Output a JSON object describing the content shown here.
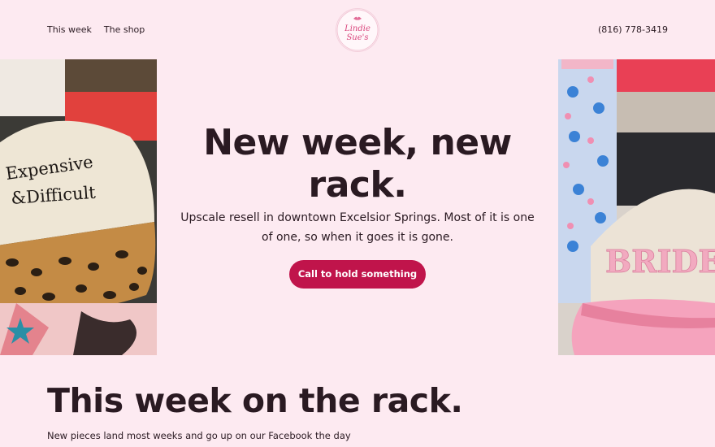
{
  "nav": {
    "items": [
      {
        "label": "This week"
      },
      {
        "label": "The shop"
      }
    ],
    "phone": "(816) 778-3419"
  },
  "logo": {
    "line1": "Lindie",
    "line2": "Sue's"
  },
  "hero": {
    "title": "New week, new rack.",
    "subtitle": "Upscale resell in downtown Excelsior Springs. Most of it is one of one, so when it goes it is gone.",
    "cta_label": "Call to hold something"
  },
  "photos": {
    "left_cap_text_1": "Expensive",
    "left_cap_text_2": "&Difficult",
    "right_cap_text": "BRIDE"
  },
  "section": {
    "title": "This week on the rack.",
    "subtitle": "New pieces land most weeks and go up on our Facebook the day"
  },
  "colors": {
    "background": "#fdeaf1",
    "accent": "#c0144b",
    "text": "#2a1a22"
  }
}
